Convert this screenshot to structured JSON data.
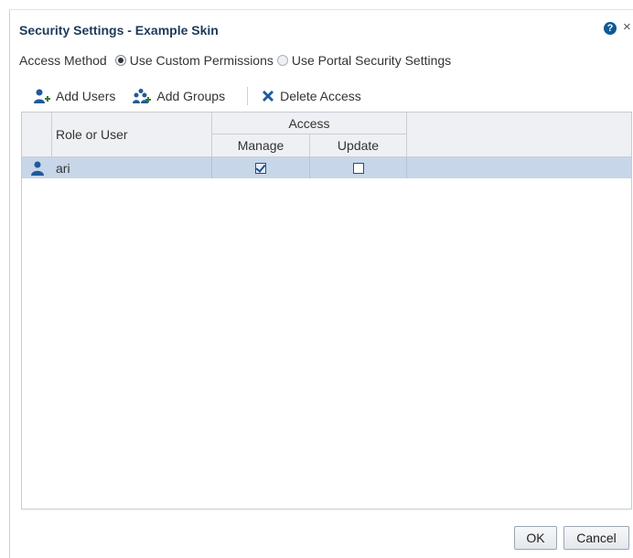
{
  "dialog": {
    "title": "Security Settings - Example Skin",
    "help_symbol": "?",
    "close_symbol": "×"
  },
  "access_method": {
    "label": "Access Method",
    "options": [
      {
        "label": "Use Custom Permissions",
        "selected": true
      },
      {
        "label": "Use Portal Security Settings",
        "selected": false
      }
    ]
  },
  "toolbar": {
    "add_users": "Add Users",
    "add_groups": "Add Groups",
    "delete_access": "Delete Access"
  },
  "table": {
    "headers": {
      "role_or_user": "Role or User",
      "access": "Access",
      "manage": "Manage",
      "update": "Update"
    },
    "rows": [
      {
        "name": "ari",
        "type_icon": "user-icon",
        "manage": true,
        "update": false,
        "selected": true
      }
    ]
  },
  "footer": {
    "ok": "OK",
    "cancel": "Cancel"
  },
  "colors": {
    "title": "#1d3a5b",
    "icon_blue": "#0e5a95",
    "selected_row": "#c7d6e8",
    "header_bg": "#eef0f3"
  }
}
